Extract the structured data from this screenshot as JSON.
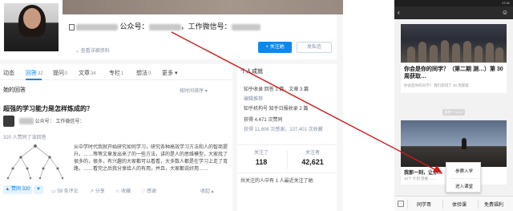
{
  "zhihu": {
    "name_prefix": "",
    "public_account_label": "公众号：",
    "work_wechat_label": "，工作微信号：",
    "view_profile": "查看详细资料",
    "follow_button": "+ 关注她",
    "message_button": "发私信",
    "tabs": [
      {
        "label": "动态",
        "count": ""
      },
      {
        "label": "回答",
        "count": "32"
      },
      {
        "label": "提问",
        "count": "0"
      },
      {
        "label": "文章",
        "count": "34"
      },
      {
        "label": "专栏",
        "count": "1"
      },
      {
        "label": "想法",
        "count": "0"
      },
      {
        "label": "更多",
        "count": ""
      }
    ],
    "section_title": "她的回答",
    "sort_label": "按时间排序",
    "question_title": "超强的学习能力是怎样炼成的？",
    "author_line": "公众号：              工作微信号：",
    "agree_line": "320 人赞同了该回答",
    "answer_body": "从中学时代我就开始研究如何学习，研究各种高效学习方法和人的智商提升。……等等文章发出来了的一些方法，讲的是人的思维模型，大家找了很多的，很多，有兴趣的大家都可以看看，大多数人都是在学习上走了弯路，……看完之后我分享给人的有用，并且，大家都说好用……",
    "vote_label": "▲ 赞同 320",
    "down_label": "▼",
    "actions": [
      "59 条评论",
      "分享",
      "收藏",
      "感谢",
      "收起"
    ],
    "side_title": "个人成就",
    "side_lines": [
      "知乎收录 回答 1 篇，文章 3 篇",
      "编辑推荐",
      "知乎机构号 知乎日报收录 2 篇",
      "获得 4,471 次赞同",
      "获得 11,806 次感谢，107,401 次收藏"
    ],
    "stats": [
      {
        "label": "关注了",
        "value": "118"
      },
      {
        "label": "关注者",
        "value": "42,621"
      }
    ],
    "side_footer": "共关注的人中有 1 人最近关注了她"
  },
  "phone": {
    "status": "17:41",
    "back_icon": "chevron-left-icon",
    "user_icon": "user-icon",
    "card1_title": "你会是你的同学？（第二期 测…）第 30 周获取…",
    "card1_source": "你会是你的同学？ 我们获得了 30 周获取",
    "timestamp": "星期一 11:41",
    "card2_title": "我那一刻，让你…",
    "card2_sub": "10个 计划 思维 ……",
    "popup_items": [
      "参赛入学",
      "进入课堂"
    ],
    "bottom_menu": [
      "同学哥",
      "体验课",
      "免费福利"
    ]
  },
  "colors": {
    "zhihu_blue": "#0f88eb",
    "annotation_arrow": "#d11a1a",
    "wechat_dark": "#2b2b2b"
  }
}
